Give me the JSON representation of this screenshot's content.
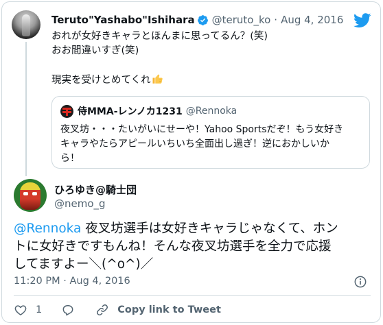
{
  "parent": {
    "author_name": "Teruto\"Yashabo\"Ishihara",
    "author_handle": "@teruto_ko",
    "separator": "·",
    "date": "Aug 4, 2016",
    "text_lines": [
      "おれが女好きキャラとほんまに思ってるん？(笑)",
      "おお間違いすぎ(笑)",
      "",
      "現実を受けとめてくれ"
    ],
    "emoji": "thumbs-up"
  },
  "quoted": {
    "author_name": "侍MMA-レンノカ1231",
    "author_handle": "@Rennoka",
    "text_lines": [
      "夜叉坊・・・たいがいにせーや！Yahoo Sportsだぞ！もう女好き",
      "キャラやたらアピールいちいち全面出し過ぎ！逆におかしいか",
      "ら！"
    ]
  },
  "tweet": {
    "author_name": "ひろゆき@騎士団",
    "author_handle": "@nemo_g",
    "mention": "@Rennoka",
    "line1_rest": " 夜叉坊選手は女好きキャラじゃなくて、ホン",
    "line2": "トに女好きですもんね！そんな夜叉坊選手を全力で応援",
    "line3": "してますよー＼(^o^)／",
    "timestamp": "11:20 PM · Aug 4, 2016"
  },
  "actions": {
    "like_count": "1",
    "copy_link_label": "Copy link to Tweet"
  },
  "colors": {
    "brand_blue": "#1d9bf0",
    "text_primary": "#0f1419",
    "text_secondary": "#536471",
    "border": "#cfd9de"
  }
}
